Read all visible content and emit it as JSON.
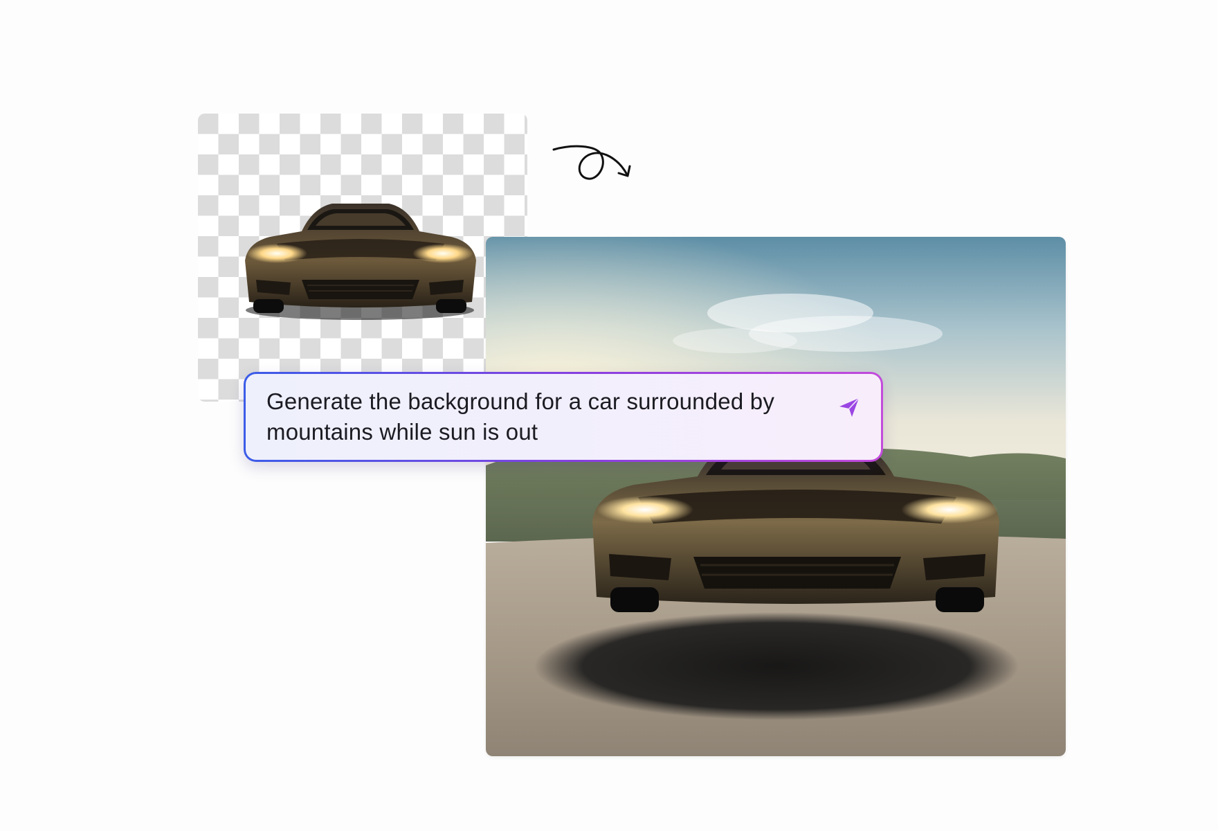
{
  "prompt": {
    "text": "Generate the background for a car surrounded by mountains while sun is out",
    "send_icon": "send-icon"
  },
  "icons": {
    "arrow": "curly-arrow-icon"
  },
  "colors": {
    "prompt_border_start": "#3b5ce8",
    "prompt_border_end": "#c34bdc",
    "send_icon": "#9b45e4",
    "checker_gray": "#dcdcdc"
  }
}
